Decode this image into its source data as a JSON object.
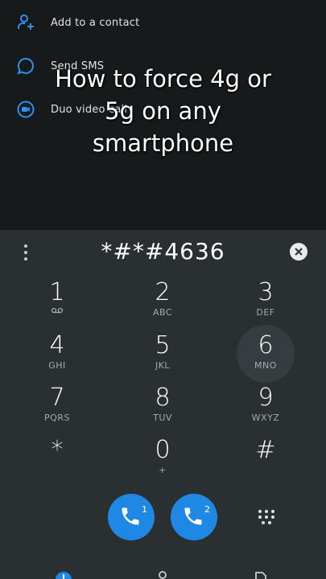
{
  "context_menu": {
    "items": [
      {
        "label": "Add to a contact",
        "icon": "add-contact-icon"
      },
      {
        "label": "Send SMS",
        "icon": "sms-icon"
      },
      {
        "label": "Duo video call",
        "icon": "duo-video-icon"
      }
    ]
  },
  "overlay": {
    "line1": "How to force 4g or",
    "line2": "5g on any",
    "line3": "smartphone"
  },
  "dialer": {
    "number": "*#*#4636",
    "keys": [
      {
        "digit": "1",
        "letters": ""
      },
      {
        "digit": "2",
        "letters": "ABC"
      },
      {
        "digit": "3",
        "letters": "DEF"
      },
      {
        "digit": "4",
        "letters": "GHI"
      },
      {
        "digit": "5",
        "letters": "JKL"
      },
      {
        "digit": "6",
        "letters": "MNO"
      },
      {
        "digit": "7",
        "letters": "PQRS"
      },
      {
        "digit": "8",
        "letters": "TUV"
      },
      {
        "digit": "9",
        "letters": "WXYZ"
      },
      {
        "digit": "*",
        "letters": ""
      },
      {
        "digit": "0",
        "letters": "+"
      },
      {
        "digit": "#",
        "letters": ""
      }
    ],
    "call_sim1": "1",
    "call_sim2": "2"
  },
  "colors": {
    "accent": "#1f88e5",
    "background": "#161a1b",
    "dialer_background": "#2a3032"
  }
}
